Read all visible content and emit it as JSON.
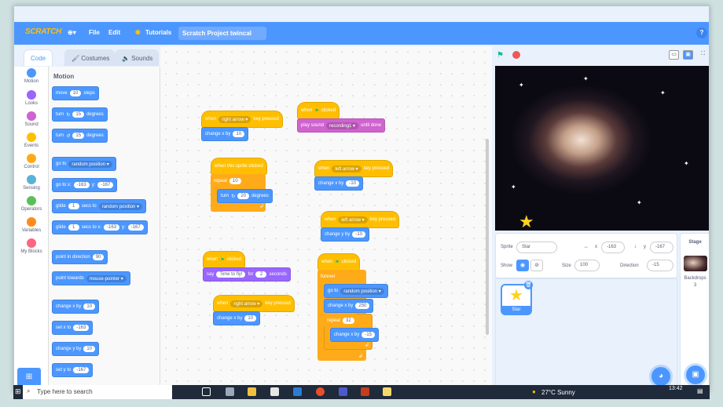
{
  "menubar": {
    "logo": "SCRATCH",
    "globe": "⊕▾",
    "file": "File",
    "edit": "Edit",
    "tutorials": "Tutorials",
    "project_title": "Scratch Project twincal",
    "help": "?"
  },
  "tabs": {
    "code": "Code",
    "costumes": "Costumes",
    "sounds": "Sounds"
  },
  "categories": [
    {
      "label": "Motion",
      "color": "#4c97ff"
    },
    {
      "label": "Looks",
      "color": "#9966ff"
    },
    {
      "label": "Sound",
      "color": "#cf63cf"
    },
    {
      "label": "Events",
      "color": "#ffbf00"
    },
    {
      "label": "Control",
      "color": "#ffab19"
    },
    {
      "label": "Sensing",
      "color": "#5cb1d6"
    },
    {
      "label": "Operators",
      "color": "#59c059"
    },
    {
      "label": "Variables",
      "color": "#ff8c1a"
    },
    {
      "label": "My Blocks",
      "color": "#ff6680"
    }
  ],
  "palette": {
    "title": "Motion",
    "move": {
      "a": "move",
      "v": "10",
      "b": "steps"
    },
    "turn_right": {
      "a": "turn",
      "icon": "↻",
      "v": "15",
      "b": "degrees"
    },
    "turn_left": {
      "a": "turn",
      "icon": "↺",
      "v": "15",
      "b": "degrees"
    },
    "goto_random": {
      "a": "go to",
      "dd": "random position ▾"
    },
    "goto_xy": {
      "a": "go to x:",
      "x": "-163",
      "b": "y:",
      "y": "-167"
    },
    "glide_random": {
      "a": "glide",
      "v": "1",
      "b": "secs to",
      "dd": "random position ▾"
    },
    "glide_xy": {
      "a": "glide",
      "v": "1",
      "b": "secs to x:",
      "x": "-163",
      "c": "y:",
      "y": "-167"
    },
    "point_dir": {
      "a": "point in direction",
      "v": "90"
    },
    "point_towards": {
      "a": "point towards",
      "dd": "mouse-pointer ▾"
    },
    "change_x": {
      "a": "change x by",
      "v": "10"
    },
    "set_x": {
      "a": "set x to",
      "v": "-163"
    },
    "change_y": {
      "a": "change y by",
      "v": "10"
    },
    "set_y": {
      "a": "set y to",
      "v": "-167"
    }
  },
  "scripts": {
    "s1": {
      "hat": "when",
      "dd": "right arrow ▾",
      "hat2": "key pressed",
      "body": "change x by",
      "v": "10"
    },
    "s2": {
      "hat": "when",
      "flag": "⚑",
      "hat2": "clicked",
      "body": "play sound",
      "dd": "recording1 ▾",
      "body2": "until done"
    },
    "s3": {
      "hat": "when this sprite clicked",
      "repeat": "repeat",
      "rv": "10",
      "turn": "turn",
      "icon": "↻",
      "tv": "20",
      "deg": "degrees",
      "loop": "↲"
    },
    "s4": {
      "hat": "when",
      "dd": "left arrow ▾",
      "hat2": "key pressed",
      "body": "change x by",
      "v": "-10"
    },
    "s5": {
      "hat": "when",
      "dd": "left arrow ▾",
      "hat2": "key pressed",
      "body": "change y by",
      "v": "-10"
    },
    "s6": {
      "hat": "when",
      "flag": "⚑",
      "hat2": "clicked",
      "say": "say",
      "text": "Time to fly!",
      "for": "for",
      "v": "2",
      "sec": "seconds"
    },
    "s7": {
      "hat": "when",
      "dd": "right arrow ▾",
      "hat2": "key pressed",
      "body": "change x by",
      "v": "10"
    },
    "s8": {
      "hat": "when",
      "flag": "⚑",
      "hat2": "clicked",
      "forever": "forever",
      "goto": "go to",
      "gdd": "random position ▾",
      "cx": "change x by",
      "cxv": "250",
      "repeat": "repeat",
      "rv": "32",
      "cxi": "change x by",
      "cxiv": "-15",
      "loop": "↲",
      "loop2": "↲"
    }
  },
  "zoom": {
    "in": "+",
    "out": "−",
    "reset": "="
  },
  "sprite_info": {
    "sprite_label": "Sprite",
    "sprite_name": "Star",
    "x_label": "x",
    "x_value": "-163",
    "y_label": "y",
    "y_value": "-167",
    "show_label": "Show",
    "size_label": "Size",
    "size_value": "100",
    "direction_label": "Direction",
    "direction_value": "-15"
  },
  "sprite_list": {
    "thumb_label": "Star"
  },
  "stage_panel": {
    "title": "Stage",
    "backdrops_label": "Backdrops",
    "backdrops_count": "3"
  },
  "taskbar": {
    "search": "Type here to search",
    "weather": "27°C Sunny",
    "time": "13:42"
  }
}
